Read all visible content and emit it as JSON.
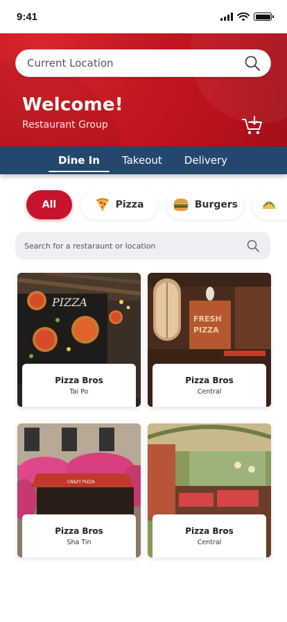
{
  "status": {
    "time": "9:41"
  },
  "header": {
    "location_label": "Current Location",
    "welcome": "Welcome!",
    "subtitle": "Restaurant Group"
  },
  "tabs": [
    {
      "label": "Dine In",
      "active": true
    },
    {
      "label": "Takeout",
      "active": false
    },
    {
      "label": "Delivery",
      "active": false
    }
  ],
  "categories": [
    {
      "label": "All",
      "icon": "",
      "active": true
    },
    {
      "label": "Pizza",
      "icon": "pizza-icon",
      "active": false
    },
    {
      "label": "Burgers",
      "icon": "burger-icon",
      "active": false
    },
    {
      "label": "",
      "icon": "taco-icon",
      "active": false
    }
  ],
  "search": {
    "placeholder": "Search for a restaraunt or location"
  },
  "restaurants": [
    {
      "name": "Pizza Bros",
      "location": "Tai Po"
    },
    {
      "name": "Pizza Bros",
      "location": "Central"
    },
    {
      "name": "Pizza Bros",
      "location": "Sha Tin"
    },
    {
      "name": "Pizza Bros",
      "location": "Central"
    }
  ],
  "colors": {
    "brand_red": "#c41820",
    "tab_bar": "#24476e",
    "chip_active": "#c8132c"
  }
}
